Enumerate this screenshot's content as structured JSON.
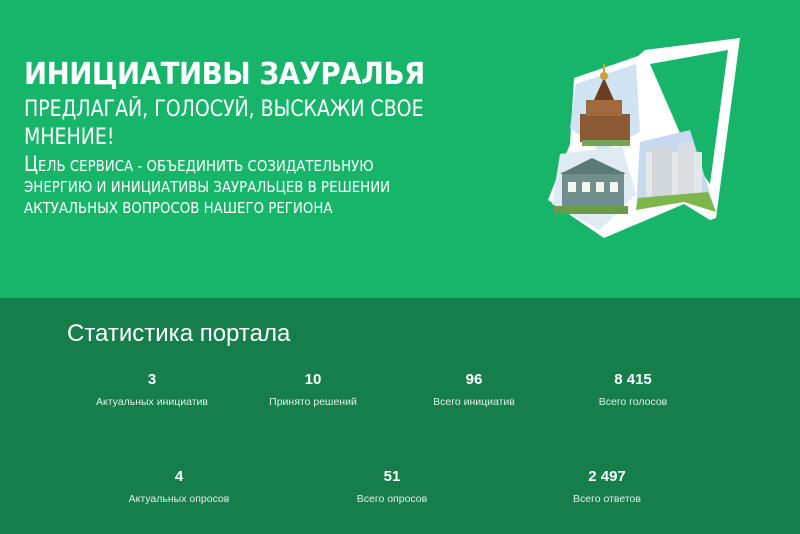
{
  "colors": {
    "hero_bg": "#16b56a",
    "stats_bg": "#157e4b",
    "text": "#ffffff"
  },
  "hero": {
    "title": "ИНИЦИАТИВЫ ЗАУРАЛЬЯ",
    "subtitle": "ПРЕДЛАГАЙ, ГОЛОСУЙ, ВЫСКАЖИ СВОЕ МНЕНИЕ!",
    "description": "Цель сервиса - объединить созидательную энергию и инициативы зауральцев в решении актуальных вопросов нашего региона"
  },
  "stats": {
    "title": "Статистика портала",
    "row1": [
      {
        "value": "3",
        "label": "Актуальных инициатив"
      },
      {
        "value": "10",
        "label": "Принято решений"
      },
      {
        "value": "96",
        "label": "Всего инициатив"
      },
      {
        "value": "8 415",
        "label": "Всего голосов"
      }
    ],
    "row2": [
      {
        "value": "4",
        "label": "Актуальных опросов"
      },
      {
        "value": "51",
        "label": "Всего опросов"
      },
      {
        "value": "2 497",
        "label": "Всего ответов"
      }
    ]
  }
}
